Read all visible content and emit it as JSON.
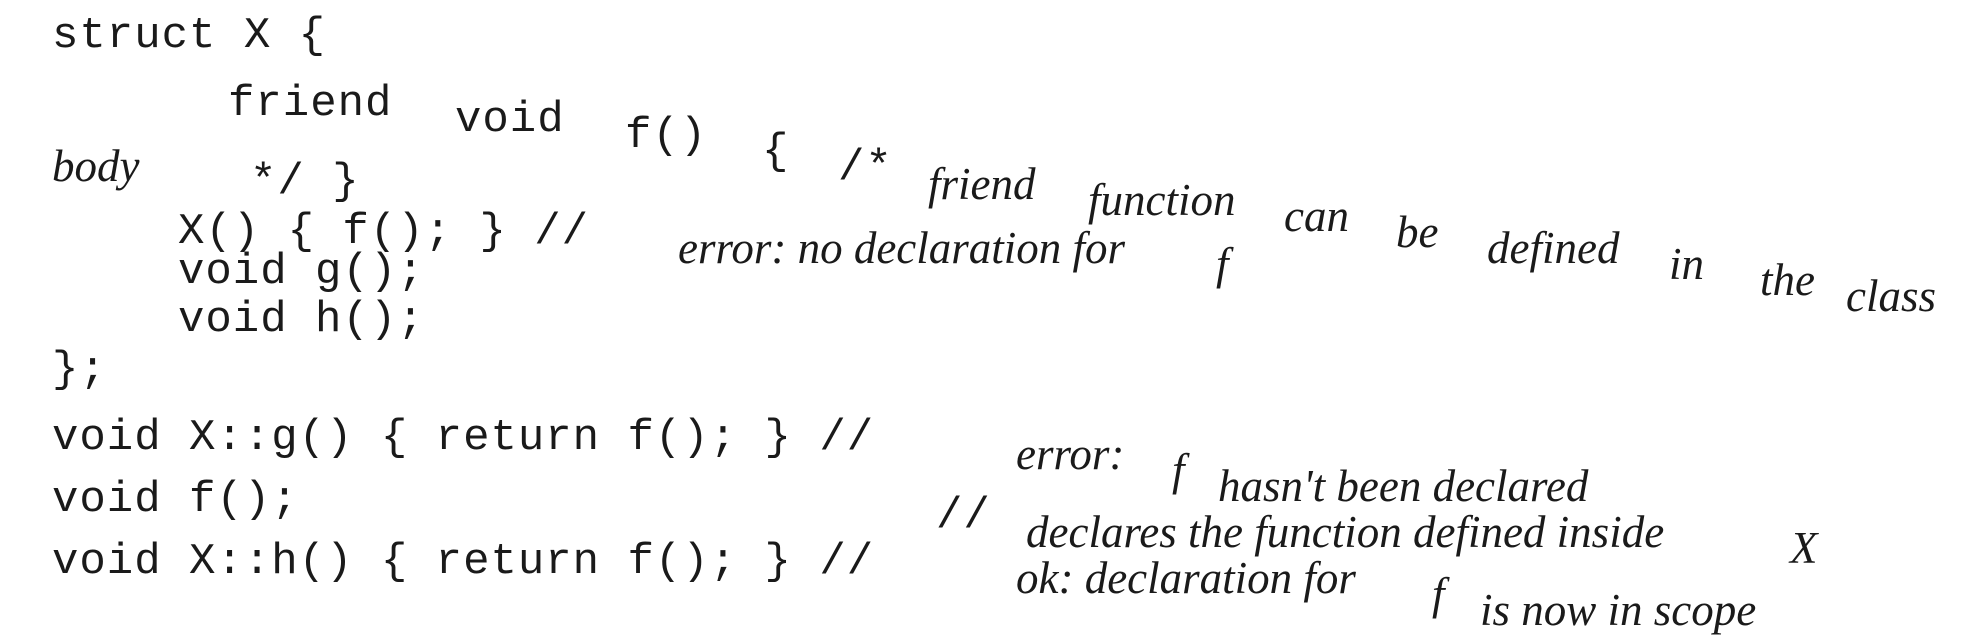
{
  "document": {
    "line1": {
      "code": "struct X {"
    },
    "line2": {
      "code_a": "friend",
      "code_b": "void",
      "code_c": "f()",
      "code_d": "{",
      "code_e": "/*",
      "comment_words": [
        "friend",
        "function",
        "can",
        "be",
        "defined",
        "in",
        "the",
        "class"
      ]
    },
    "line3": {
      "comment": "body",
      "code": "*/ }"
    },
    "line4": {
      "code": "X() { f(); } //",
      "comment_a": "error: no declaration for",
      "comment_b": "f"
    },
    "line5": {
      "code": "void g();"
    },
    "line6": {
      "code": "void h();"
    },
    "line7": {
      "code": "};"
    },
    "line8": {
      "code": "void X::g() { return f(); } //",
      "comment_a": "error:",
      "comment_b": "f",
      "comment_c": "hasn't been declared"
    },
    "line9": {
      "code_a": "void f();",
      "code_b": "//",
      "comment_a": "declares the function defined inside",
      "comment_b": "X"
    },
    "line10": {
      "code": "void X::h() { return f(); } //",
      "comment_a": "ok: declaration for",
      "comment_b": "f",
      "comment_c": "is now in scope"
    }
  }
}
